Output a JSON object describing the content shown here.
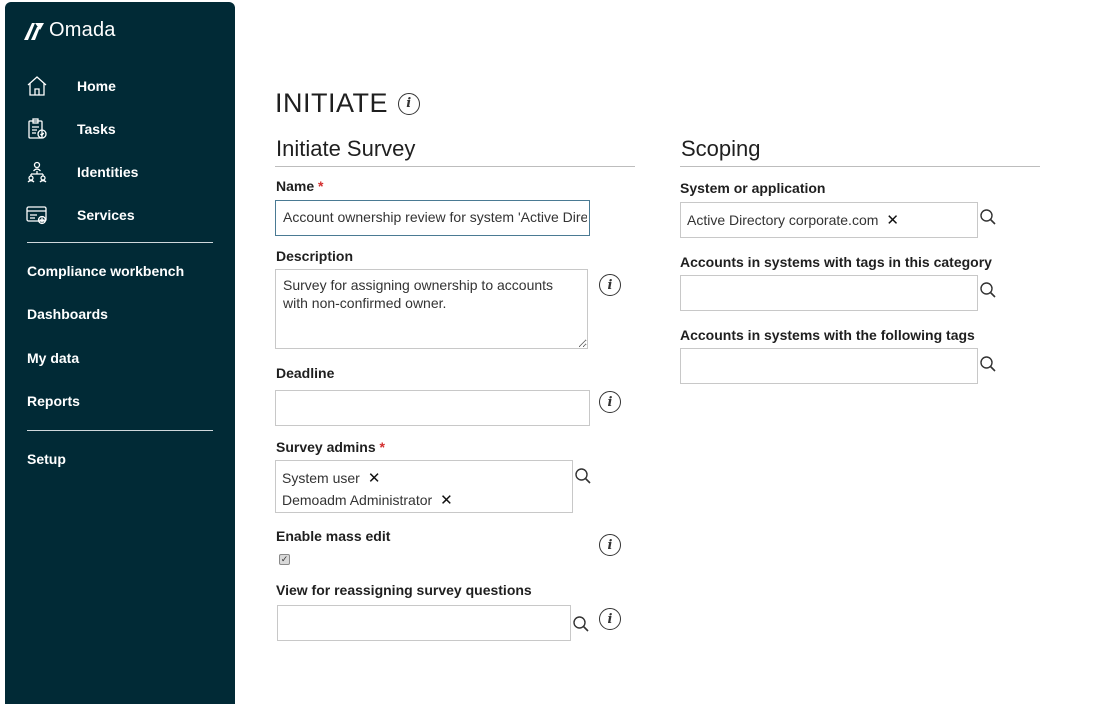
{
  "app": {
    "logo_text": "Omada"
  },
  "sidebar": {
    "items": [
      {
        "label": "Home",
        "icon": "home-icon"
      },
      {
        "label": "Tasks",
        "icon": "clipboard-icon"
      },
      {
        "label": "Identities",
        "icon": "org-chart-icon"
      },
      {
        "label": "Services",
        "icon": "services-icon"
      }
    ],
    "links": [
      {
        "label": "Compliance workbench"
      },
      {
        "label": "Dashboards"
      },
      {
        "label": "My data"
      },
      {
        "label": "Reports"
      }
    ],
    "bottom_links": [
      {
        "label": "Setup"
      }
    ]
  },
  "page": {
    "title": "INITIATE"
  },
  "initiate_section": {
    "title": "Initiate Survey",
    "name_label": "Name",
    "name_value": "Account ownership review for system 'Active Directory corporate.com'",
    "description_label": "Description",
    "description_value": "Survey for assigning ownership to accounts with non-confirmed owner.",
    "deadline_label": "Deadline",
    "deadline_value": "",
    "survey_admins_label": "Survey admins",
    "survey_admins": [
      "System user",
      "Demoadm Administrator"
    ],
    "mass_edit_label": "Enable mass edit",
    "mass_edit_checked": true,
    "view_label": "View for reassigning survey questions",
    "view_value": "",
    "required_marker": "*"
  },
  "scoping_section": {
    "title": "Scoping",
    "system_label": "System or application",
    "system_tag": "Active Directory corporate.com",
    "tags_category_label": "Accounts in systems with tags in this category",
    "tags_category_value": "",
    "following_tags_label": "Accounts in systems with the following tags",
    "following_tags_value": ""
  },
  "colors": {
    "sidebar_bg": "#012a36",
    "required": "#d32f2f",
    "focus_border": "#4a7a93"
  }
}
